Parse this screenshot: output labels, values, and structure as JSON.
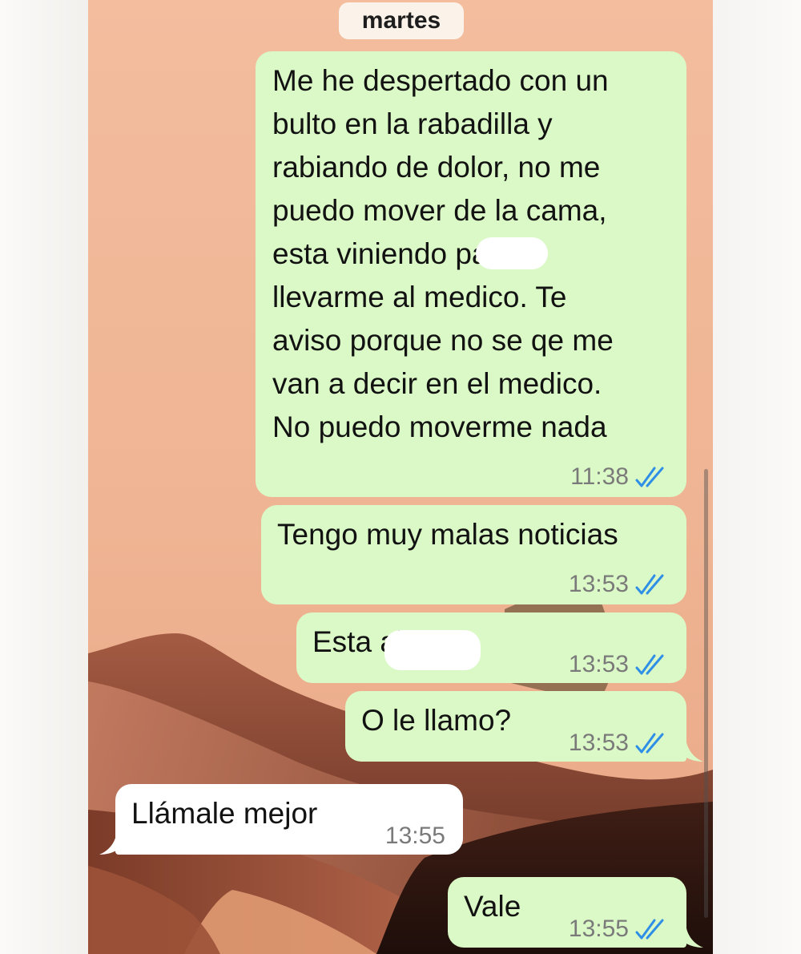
{
  "date_chip": "martes",
  "messages": [
    {
      "direction": "outgoing",
      "text": "Me he despertado con un\nbulto en la rabadilla y\nrabiando de dolor, no me\npuedo mover de la cama,\nesta viniendo            para\nllevarme al medico. Te\naviso porque no se qe me\nvan a decir en el medico.\nNo puedo moverme nada",
      "time": "11:38",
      "status_icon": "double-check-read-icon"
    },
    {
      "direction": "outgoing",
      "text": "Tengo muy malas noticias",
      "time": "13:53",
      "status_icon": "double-check-read-icon"
    },
    {
      "direction": "outgoing",
      "text": "Esta              alli?",
      "time": "13:53",
      "status_icon": "double-check-read-icon"
    },
    {
      "direction": "outgoing",
      "text": "O le llamo?",
      "time": "13:53",
      "status_icon": "double-check-read-icon"
    },
    {
      "direction": "incoming",
      "text": "Llámale mejor",
      "time": "13:55"
    },
    {
      "direction": "outgoing",
      "text": "Vale",
      "time": "13:55",
      "status_icon": "double-check-read-icon"
    }
  ],
  "colors": {
    "outgoing_bubble": "#dbf9c6",
    "incoming_bubble": "#ffffff",
    "read_check": "#2f8fe6",
    "wallpaper_sky": "#f3bd9e",
    "dune": "#8a4a35"
  },
  "background": "desert-dunes-wallpaper"
}
